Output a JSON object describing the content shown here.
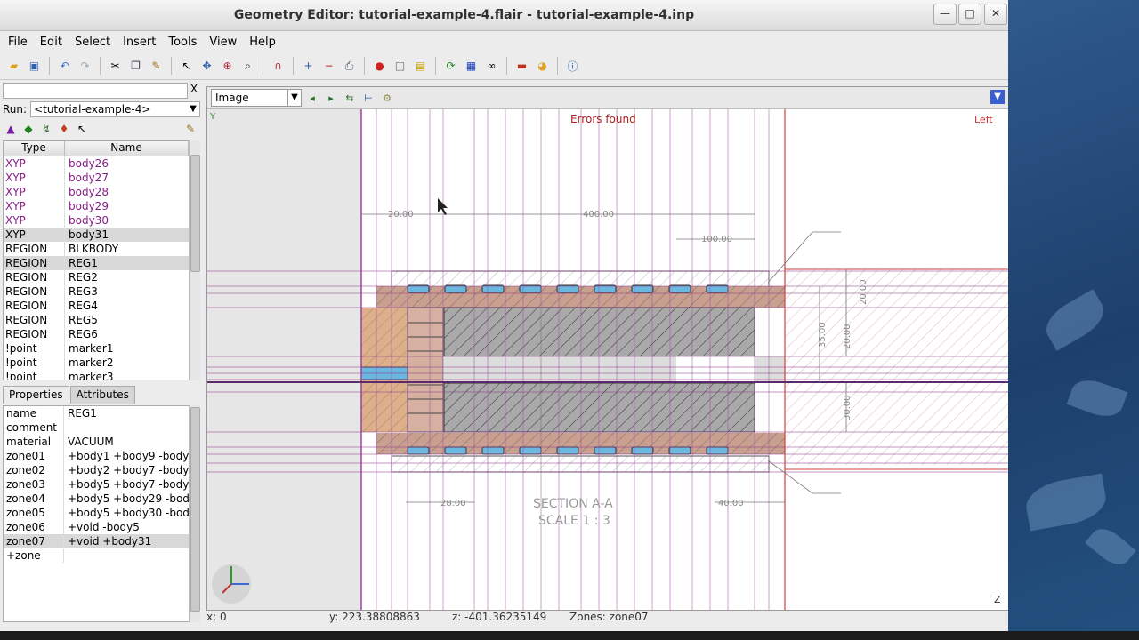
{
  "window": {
    "title": "Geometry Editor: tutorial-example-4.flair - tutorial-example-4.inp",
    "minimize": "—",
    "maximize": "□",
    "close": "✕"
  },
  "menu": [
    "File",
    "Edit",
    "Select",
    "Insert",
    "Tools",
    "View",
    "Help"
  ],
  "toolbar_icons": [
    "open-icon",
    "save-icon",
    "undo-icon",
    "redo-icon",
    "cut-icon",
    "copy-icon",
    "paste-icon",
    "select-icon",
    "pan-icon",
    "zoom-region-icon",
    "zoom-icon",
    "magnet-icon",
    "zoom-in-icon",
    "zoom-out-icon",
    "print-icon",
    "red-sphere-icon",
    "cube-icon",
    "lock-icon",
    "refresh-icon",
    "color-grid-icon",
    "infinity-icon",
    "ruler-icon",
    "palette-icon",
    "info-icon"
  ],
  "left": {
    "search_clear": "X",
    "run_label": "Run:",
    "run_value": "<tutorial-example-4>",
    "list_headers": [
      "Type",
      "Name"
    ],
    "rows": [
      {
        "type": "XYP",
        "name": "body26",
        "purple": true
      },
      {
        "type": "XYP",
        "name": "body27",
        "purple": true
      },
      {
        "type": "XYP",
        "name": "body28",
        "purple": true
      },
      {
        "type": "XYP",
        "name": "body29",
        "purple": true
      },
      {
        "type": "XYP",
        "name": "body30",
        "purple": true
      },
      {
        "type": "XYP",
        "name": "body31",
        "purple": false,
        "selected": true
      },
      {
        "type": "REGION",
        "name": "BLKBODY",
        "purple": false
      },
      {
        "type": "REGION",
        "name": "REG1",
        "purple": false,
        "selected": true
      },
      {
        "type": "REGION",
        "name": "REG2",
        "purple": false
      },
      {
        "type": "REGION",
        "name": "REG3",
        "purple": false
      },
      {
        "type": "REGION",
        "name": "REG4",
        "purple": false
      },
      {
        "type": "REGION",
        "name": "REG5",
        "purple": false
      },
      {
        "type": "REGION",
        "name": "REG6",
        "purple": false
      },
      {
        "type": "!point",
        "name": "marker1",
        "purple": false
      },
      {
        "type": "!point",
        "name": "marker2",
        "purple": false
      },
      {
        "type": "!point",
        "name": "marker3",
        "purple": false
      }
    ],
    "tabs": [
      "Properties",
      "Attributes"
    ],
    "props": [
      {
        "k": "name",
        "v": "REG1"
      },
      {
        "k": "comment",
        "v": ""
      },
      {
        "k": "material",
        "v": "VACUUM"
      },
      {
        "k": "zone01",
        "v": "+body1 +body9 -body"
      },
      {
        "k": "zone02",
        "v": "+body2 +body7 -body"
      },
      {
        "k": "zone03",
        "v": "+body5 +body7 -body"
      },
      {
        "k": "zone04",
        "v": "+body5 +body29 -bod"
      },
      {
        "k": "zone05",
        "v": "+body5 +body30 -bod"
      },
      {
        "k": "zone06",
        "v": "+void -body5"
      },
      {
        "k": "zone07",
        "v": "+void +body31",
        "selected": true
      },
      {
        "k": "+zone",
        "v": ""
      }
    ]
  },
  "viewer": {
    "image_select": "Image",
    "errors": "Errors found",
    "view_label": "Left",
    "section_line1": "SECTION A-A",
    "section_line2": "SCALE 1 : 3",
    "dims": [
      "20.00",
      "400.00",
      "100.00",
      "20.00",
      "35.00",
      "20.00",
      "30.00",
      "28.00",
      "40.00"
    ],
    "axis_y": "Y",
    "axis_z": "Z"
  },
  "status": {
    "x": "x: 0",
    "y": "y: 223.38808863",
    "z": "z: -401.36235149",
    "zones": "Zones: zone07"
  }
}
